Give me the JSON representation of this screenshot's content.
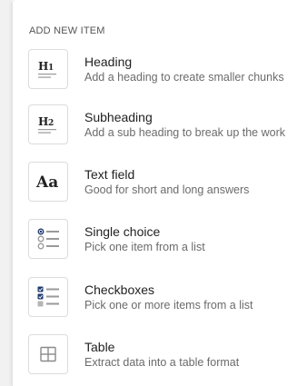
{
  "panel": {
    "section_title": "ADD NEW ITEM",
    "items": [
      {
        "label": "Heading",
        "description": "Add a heading to create smaller chunks",
        "icon": "heading-1-icon",
        "icon_text": "H1"
      },
      {
        "label": "Subheading",
        "description": "Add a sub heading to break up the work",
        "icon": "heading-2-icon",
        "icon_text": "H2"
      },
      {
        "label": "Text field",
        "description": "Good for short and long answers",
        "icon": "text-field-icon",
        "icon_text": "Aa"
      },
      {
        "label": "Single choice",
        "description": "Pick one item from a list",
        "icon": "radio-list-icon"
      },
      {
        "label": "Checkboxes",
        "description": "Pick one or more items from a list",
        "icon": "checkbox-list-icon"
      },
      {
        "label": "Table",
        "description": "Extract data into a table format",
        "icon": "table-icon"
      }
    ]
  },
  "colors": {
    "accent": "#1e3a6e",
    "icon_gray": "#9a9a9a",
    "border": "#dcdcdc"
  }
}
